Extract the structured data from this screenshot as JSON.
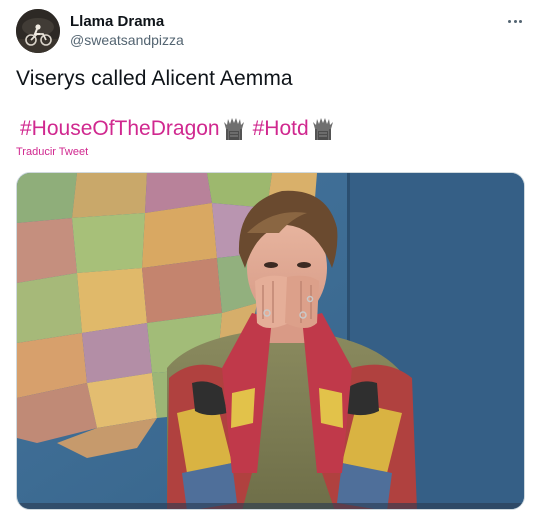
{
  "author": {
    "name": "Llama Drama",
    "handle": "@sweatsandpizza",
    "avatar_icon": "motorcycle-rider-avatar"
  },
  "menu": {
    "icon": "more-options-icon"
  },
  "tweet": {
    "text": "Viserys called Alicent Aemma",
    "hashtags": [
      "#HouseOfTheDragon",
      "#Hotd"
    ],
    "hashtag_emoji": "iron-throne-icon",
    "translate_label": "Traducir Tweet"
  },
  "media": {
    "type": "image",
    "alt_description": "man covering his mouth with both hands in front of a US map"
  },
  "colors": {
    "hashtag": "#d0288f",
    "text": "#0f1419",
    "secondary": "#536471",
    "border": "#cfd9de"
  }
}
